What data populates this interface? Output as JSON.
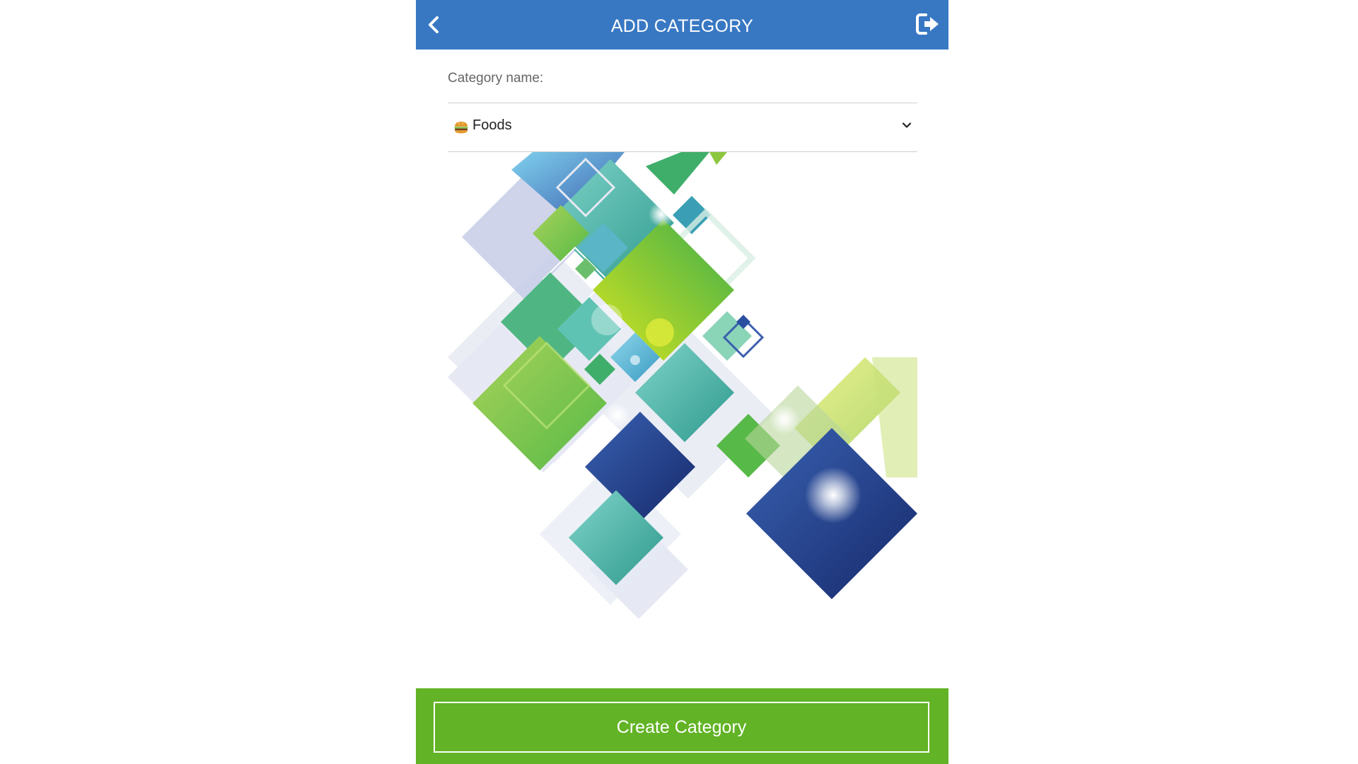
{
  "header": {
    "title": "ADD CATEGORY",
    "back_icon": "chevron-left-icon",
    "logout_icon": "sign-out-icon"
  },
  "form": {
    "category_label": "Category name:",
    "category_select": {
      "selected_icon": "burger-icon",
      "selected_value": "Foods"
    }
  },
  "illustration": {
    "name": "geometric-diamonds-illustration",
    "palette": [
      "#3b5fad",
      "#5bbad9",
      "#4fb683",
      "#8dc63f",
      "#c4d92e",
      "#1b3275",
      "#e6e9f3"
    ]
  },
  "footer": {
    "create_button_label": "Create Category"
  },
  "colors": {
    "header_bg": "#3878c3",
    "footer_bg": "#62b325",
    "text_muted": "#666666"
  }
}
